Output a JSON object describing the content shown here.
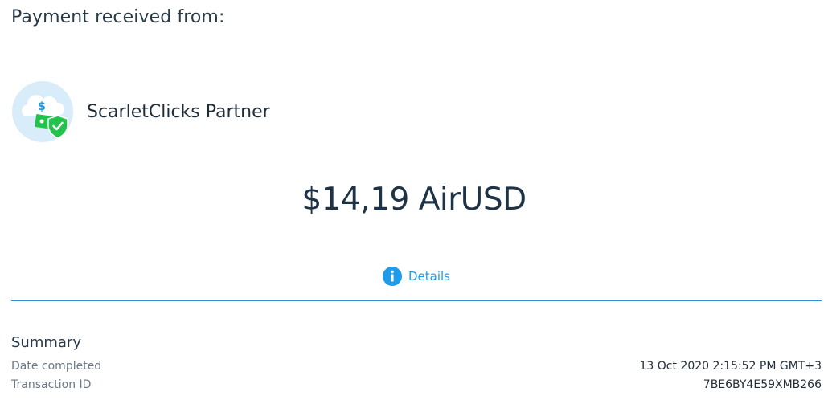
{
  "header": {
    "title": "Payment received from:"
  },
  "sender": {
    "name": "ScarletClicks Partner",
    "icon": "cloud-money-shield-icon",
    "colors": {
      "cloud": "#d8ecfa",
      "money": "#23c24a",
      "dollar": "#1e9ce8"
    }
  },
  "payment": {
    "amount": "$14,19 AirUSD"
  },
  "details": {
    "label": "Details",
    "icon": "info-icon",
    "color": "#1e9ce8"
  },
  "summary": {
    "title": "Summary",
    "rows": [
      {
        "label": "Date completed",
        "value": "13 Oct 2020 2:15:52 PM GMT+3"
      },
      {
        "label": "Transaction ID",
        "value": "7BE6BY4E59XMB266"
      }
    ]
  }
}
